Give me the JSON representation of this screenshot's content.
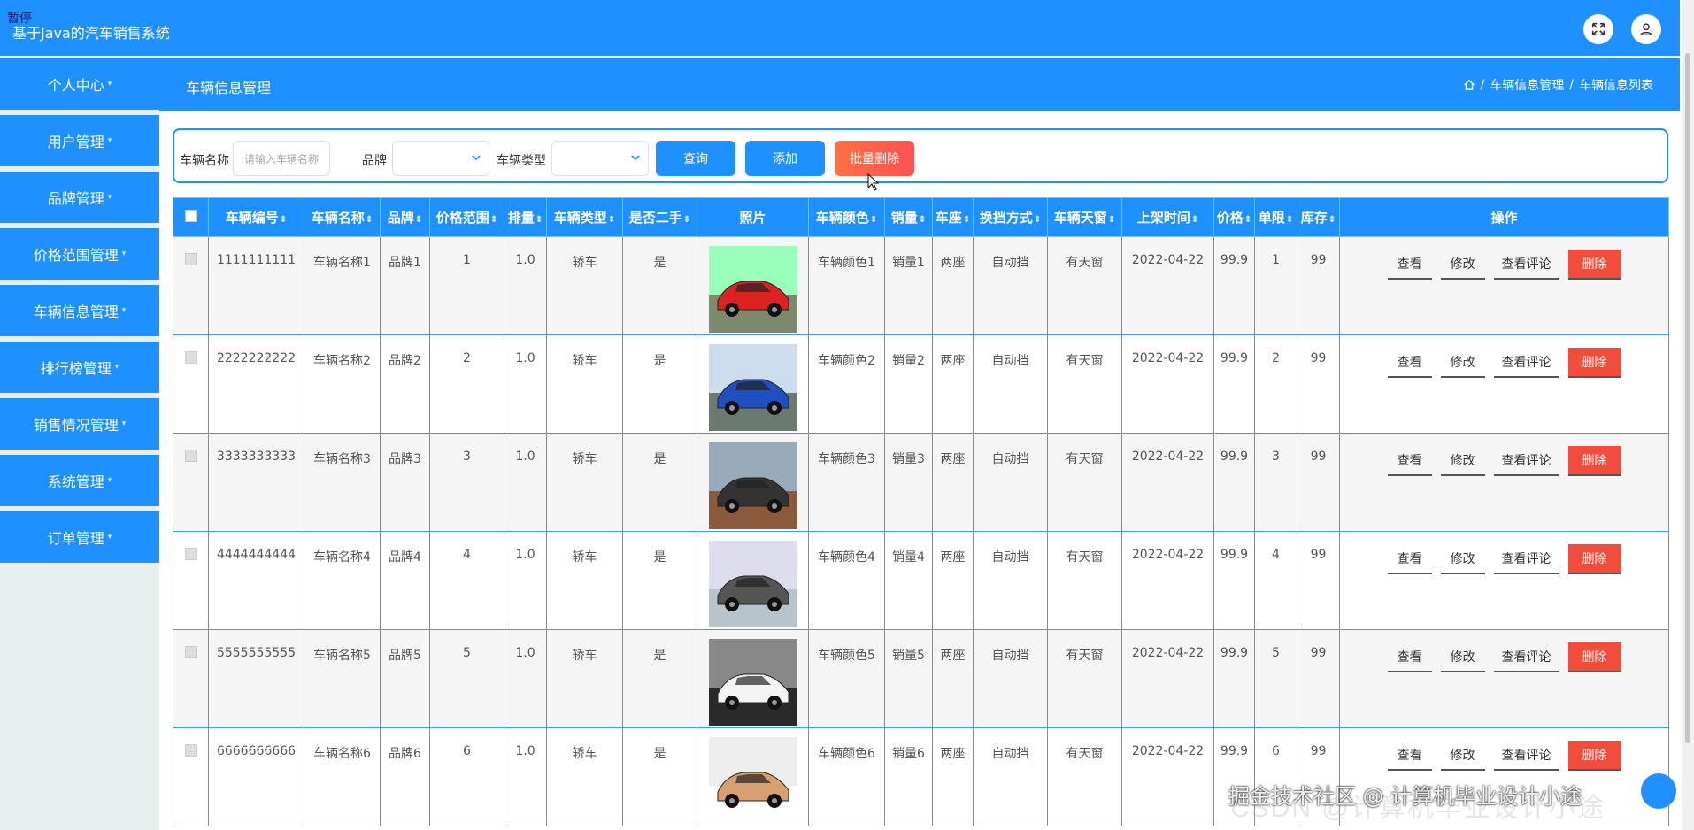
{
  "app": {
    "paused_badge": "暂停",
    "title": "基于Java的汽车销售系统"
  },
  "colors": {
    "accent": "#1e90ff",
    "danger": "#f24c3d"
  },
  "icons": {
    "fullscreen": "expand-icon",
    "user": "user-icon",
    "home": "home-icon"
  },
  "sidebar": {
    "items": [
      {
        "label": "个人中心"
      },
      {
        "label": "用户管理"
      },
      {
        "label": "品牌管理"
      },
      {
        "label": "价格范围管理"
      },
      {
        "label": "车辆信息管理"
      },
      {
        "label": "排行榜管理"
      },
      {
        "label": "销售情况管理"
      },
      {
        "label": "系统管理"
      },
      {
        "label": "订单管理"
      }
    ]
  },
  "subheader": {
    "title": "车辆信息管理",
    "breadcrumb": [
      "车辆信息管理",
      "车辆信息列表"
    ],
    "separator": "/"
  },
  "search": {
    "name_label": "车辆名称",
    "name_placeholder": "请输入车辆名称",
    "brand_label": "品牌",
    "type_label": "车辆类型",
    "query_btn": "查询",
    "add_btn": "添加",
    "batch_delete_btn": "批量删除"
  },
  "table": {
    "headers": [
      "车辆编号",
      "车辆名称",
      "品牌",
      "价格范围",
      "排量",
      "车辆类型",
      "是否二手",
      "照片",
      "车辆颜色",
      "销量",
      "车座",
      "换挡方式",
      "车辆天窗",
      "上架时间",
      "价格",
      "单限",
      "库存",
      "操作"
    ],
    "actions": {
      "view": "查看",
      "edit": "修改",
      "comments": "查看评论",
      "delete": "删除"
    },
    "rows": [
      {
        "id": "1111111111",
        "name": "车辆名称1",
        "brand": "品牌1",
        "price_range": "1",
        "displacement": "1.0",
        "type": "轿车",
        "used": "是",
        "photo": "red-sports-car",
        "color": "车辆颜色1",
        "sales": "销量1",
        "seats": "两座",
        "gear": "自动挡",
        "sunroof": "有天窗",
        "date": "2022-04-22",
        "price": "99.9",
        "limit": "1",
        "stock": "99"
      },
      {
        "id": "2222222222",
        "name": "车辆名称2",
        "brand": "品牌2",
        "price_range": "2",
        "displacement": "1.0",
        "type": "轿车",
        "used": "是",
        "photo": "blue-coupe",
        "color": "车辆颜色2",
        "sales": "销量2",
        "seats": "两座",
        "gear": "自动挡",
        "sunroof": "有天窗",
        "date": "2022-04-22",
        "price": "99.9",
        "limit": "2",
        "stock": "99"
      },
      {
        "id": "3333333333",
        "name": "车辆名称3",
        "brand": "品牌3",
        "price_range": "3",
        "displacement": "1.0",
        "type": "轿车",
        "used": "是",
        "photo": "dark-sedan",
        "color": "车辆颜色3",
        "sales": "销量3",
        "seats": "两座",
        "gear": "自动挡",
        "sunroof": "有天窗",
        "date": "2022-04-22",
        "price": "99.9",
        "limit": "3",
        "stock": "99"
      },
      {
        "id": "4444444444",
        "name": "车辆名称4",
        "brand": "品牌4",
        "price_range": "4",
        "displacement": "1.0",
        "type": "轿车",
        "used": "是",
        "photo": "gray-sedan",
        "color": "车辆颜色4",
        "sales": "销量4",
        "seats": "两座",
        "gear": "自动挡",
        "sunroof": "有天窗",
        "date": "2022-04-22",
        "price": "99.9",
        "limit": "4",
        "stock": "99"
      },
      {
        "id": "5555555555",
        "name": "车辆名称5",
        "brand": "品牌5",
        "price_range": "5",
        "displacement": "1.0",
        "type": "轿车",
        "used": "是",
        "photo": "white-hatchback",
        "color": "车辆颜色5",
        "sales": "销量5",
        "seats": "两座",
        "gear": "自动挡",
        "sunroof": "有天窗",
        "date": "2022-04-22",
        "price": "99.9",
        "limit": "5",
        "stock": "99"
      },
      {
        "id": "6666666666",
        "name": "车辆名称6",
        "brand": "品牌6",
        "price_range": "6",
        "displacement": "1.0",
        "type": "轿车",
        "used": "是",
        "photo": "gold-sports-car",
        "color": "车辆颜色6",
        "sales": "销量6",
        "seats": "两座",
        "gear": "自动挡",
        "sunroof": "有天窗",
        "date": "2022-04-22",
        "price": "99.9",
        "limit": "6",
        "stock": "99"
      }
    ]
  },
  "watermark": {
    "text": "掘金技术社区 @ 计算机毕业设计小途",
    "faint": "CSDN @计算机毕业设计小途"
  }
}
